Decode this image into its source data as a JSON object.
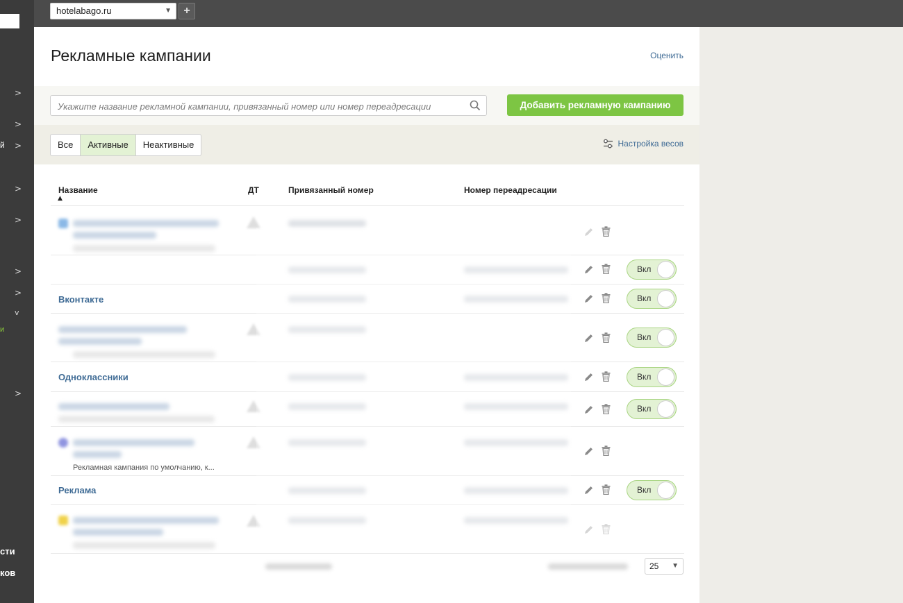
{
  "sidebar": {
    "fragments": {
      "item_3": "й",
      "item_active": "и",
      "bottom_1": "сти",
      "bottom_2": "ков"
    },
    "chevron": ">",
    "chevron_open": "v"
  },
  "topbar": {
    "site_select": "hotelabago.ru",
    "add_site_icon": "plus-icon"
  },
  "header": {
    "title": "Рекламные кампании",
    "rate_link": "Оценить"
  },
  "search": {
    "placeholder": "Укажите название рекламной кампании, привязанный номер или номер переадресации",
    "add_button": "Добавить рекламную кампанию"
  },
  "filters": {
    "tabs": [
      "Все",
      "Активные",
      "Неактивные"
    ],
    "selected": "Активные",
    "weights_link": "Настройка весов"
  },
  "table": {
    "columns": {
      "name": "Название",
      "dt": "ДТ",
      "linked_number": "Привязанный номер",
      "redirect_number": "Номер переадресации"
    },
    "rows": [
      {
        "name": "",
        "toggle": ""
      },
      {
        "name": "",
        "toggle": "Вкл"
      },
      {
        "name": "Вконтакте",
        "toggle": "Вкл"
      },
      {
        "name": "",
        "toggle": "Вкл"
      },
      {
        "name": "Одноклассники",
        "toggle": "Вкл"
      },
      {
        "name": "",
        "toggle": "Вкл"
      },
      {
        "name": "",
        "desc": "Рекламная кампания по умолчанию, к...",
        "toggle": ""
      },
      {
        "name": "Реклама",
        "toggle": "Вкл"
      },
      {
        "name": "",
        "toggle": ""
      }
    ]
  },
  "pagination": {
    "per_page": "25"
  },
  "colors": {
    "accent_green": "#7dc543",
    "link_blue": "#3f6b95",
    "sidebar_bg": "#3b3b3b",
    "topbar_bg": "#4b4b4b"
  }
}
